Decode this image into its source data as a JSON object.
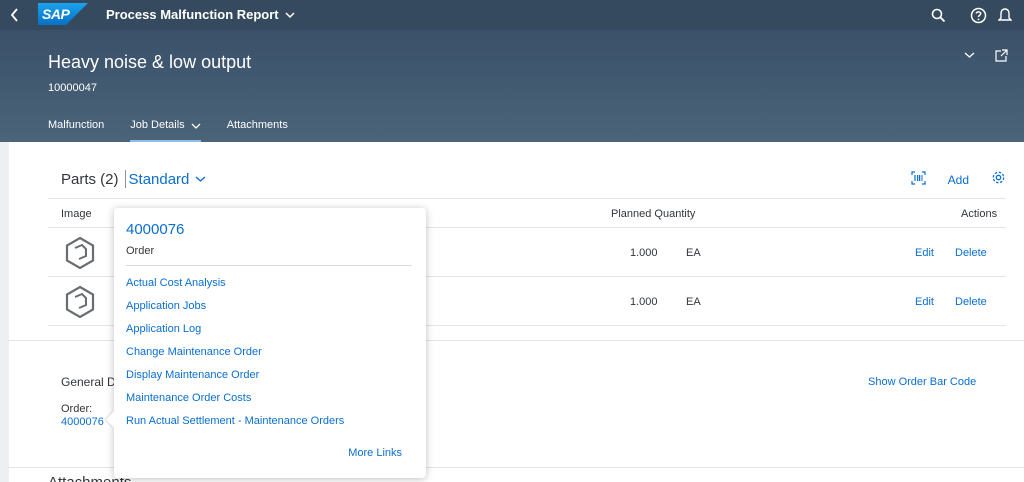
{
  "shell": {
    "title": "Process Malfunction Report",
    "logo_text": "SAP",
    "back_icon": "chevron-left-icon",
    "icons": [
      "search-icon",
      "help-icon",
      "notification-icon"
    ]
  },
  "header": {
    "title": "Heavy noise & low output",
    "subtitle": "10000047",
    "tabs": [
      {
        "label": "Malfunction"
      },
      {
        "label": "Job Details"
      },
      {
        "label": "Attachments"
      }
    ]
  },
  "parts": {
    "title": "Parts (2)",
    "variant": "Standard",
    "add_label": "Add",
    "columns": {
      "image": "Image",
      "planned_quantity": "Planned Quantity",
      "actions": "Actions"
    },
    "rows": [
      {
        "quantity": "1.000",
        "uom": "EA",
        "edit": "Edit",
        "delete": "Delete"
      },
      {
        "quantity": "1.000",
        "uom": "EA",
        "edit": "Edit",
        "delete": "Delete"
      }
    ]
  },
  "general": {
    "title": "General D",
    "order_label": "Order:",
    "order_value": "4000076",
    "barcode_link": "Show Order Bar Code"
  },
  "attachments_heading": "Attachments",
  "popover": {
    "title": "4000076",
    "subtitle": "Order",
    "links": [
      "Actual Cost Analysis",
      "Application Jobs",
      "Application Log",
      "Change Maintenance Order",
      "Display Maintenance Order",
      "Maintenance Order Costs",
      "Run Actual Settlement - Maintenance Orders"
    ],
    "more": "More Links"
  },
  "colors": {
    "shell": "#354a5f",
    "link": "#0a6ed1",
    "text": "#32363a"
  }
}
